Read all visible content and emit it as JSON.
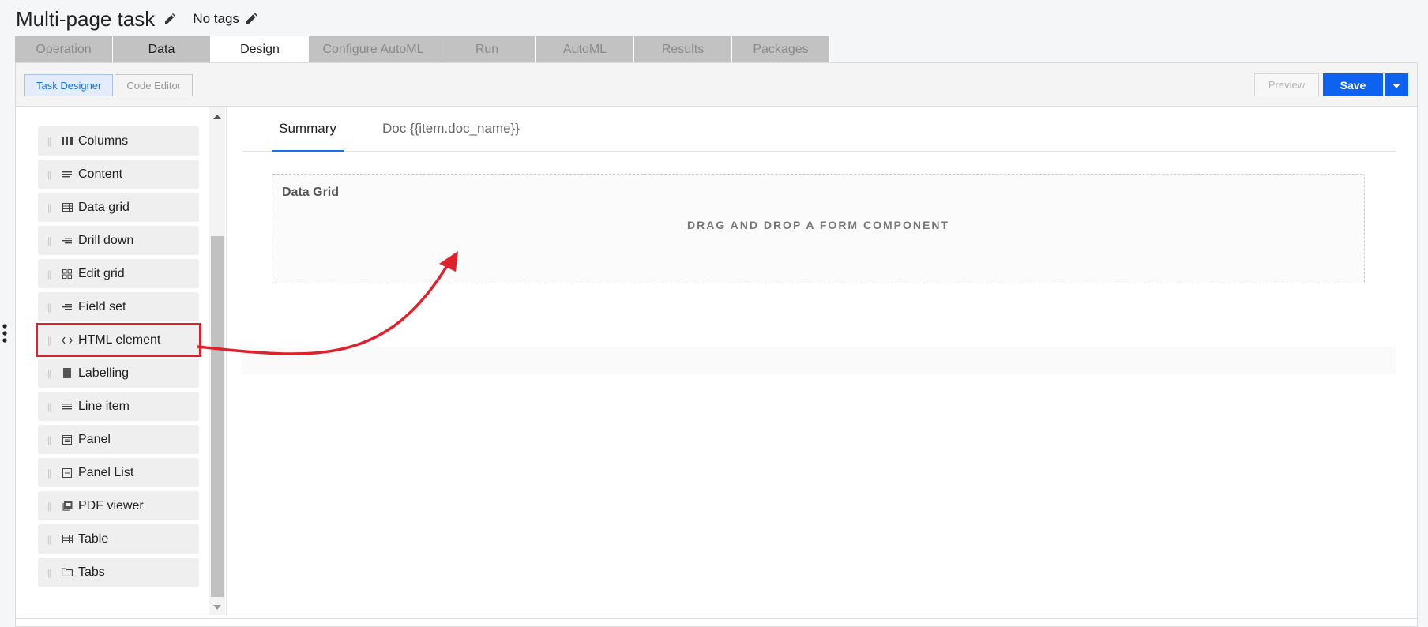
{
  "header": {
    "title": "Multi-page task",
    "tags": "No tags",
    "edit_title_icon": "pencil-icon",
    "edit_tags_icon": "pencil-icon"
  },
  "tabs": [
    {
      "label": "Operation",
      "state": "inactive"
    },
    {
      "label": "Data",
      "state": "inactive-dark"
    },
    {
      "label": "Design",
      "state": "active"
    },
    {
      "label": "Configure AutoML",
      "state": "inactive"
    },
    {
      "label": "Run",
      "state": "inactive"
    },
    {
      "label": "AutoML",
      "state": "inactive"
    },
    {
      "label": "Results",
      "state": "inactive"
    },
    {
      "label": "Packages",
      "state": "inactive"
    }
  ],
  "toolbar": {
    "task_designer": "Task Designer",
    "code_editor": "Code Editor",
    "preview": "Preview",
    "save": "Save"
  },
  "components": [
    {
      "label": "Columns",
      "icon": "columns-icon"
    },
    {
      "label": "Content",
      "icon": "content-icon"
    },
    {
      "label": "Data grid",
      "icon": "grid-icon"
    },
    {
      "label": "Drill down",
      "icon": "list-icon"
    },
    {
      "label": "Edit grid",
      "icon": "edit-grid-icon"
    },
    {
      "label": "Field set",
      "icon": "list-icon"
    },
    {
      "label": "HTML element",
      "icon": "code-icon"
    },
    {
      "label": "Labelling",
      "icon": "rectangle-icon"
    },
    {
      "label": "Line item",
      "icon": "lines-icon"
    },
    {
      "label": "Panel",
      "icon": "panel-icon"
    },
    {
      "label": "Panel List",
      "icon": "panel-icon"
    },
    {
      "label": "PDF viewer",
      "icon": "pdf-icon"
    },
    {
      "label": "Table",
      "icon": "grid-icon"
    },
    {
      "label": "Tabs",
      "icon": "folder-icon"
    }
  ],
  "content": {
    "tabs": [
      {
        "label": "Summary"
      },
      {
        "label": "Doc {{item.doc_name}}"
      }
    ],
    "dropzone_title": "Data Grid",
    "dropzone_hint": "DRAG AND DROP A FORM COMPONENT"
  },
  "colors": {
    "accent": "#1a73e8",
    "save": "#0d63f0",
    "annotation": "#e0202a"
  }
}
